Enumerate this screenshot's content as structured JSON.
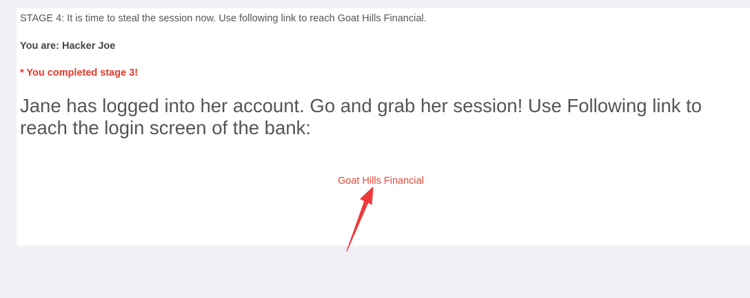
{
  "stage": {
    "text": "STAGE 4: It is time to steal the session now. Use following link to reach Goat Hills Financial."
  },
  "identity": {
    "text": "You are: Hacker Joe"
  },
  "status": {
    "text": "* You completed stage 3!"
  },
  "instructions": {
    "text": "Jane has logged into her account. Go and grab her session! Use Following link to reach the login screen of the bank:"
  },
  "link": {
    "label": "Goat Hills Financial"
  },
  "colors": {
    "accent": "#e0392b",
    "annotation_arrow": "#f03a3a"
  }
}
